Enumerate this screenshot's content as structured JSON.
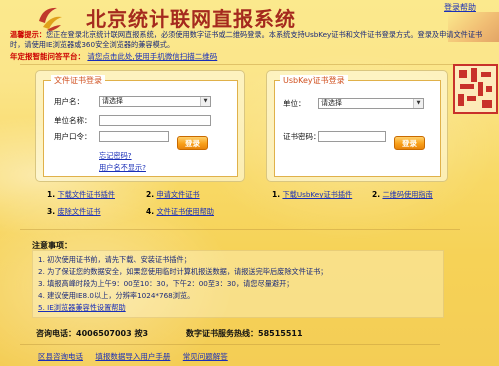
{
  "header": {
    "site_title": "北京统计联网直报系统",
    "login_help": "登录帮助"
  },
  "notice": {
    "label": "温馨提示：",
    "text": "您正在登录北京统计联网直报系统，必须使用数字证书或二维码登录。本系统支持UsbKey证书和文件证书登录方式。登录及申请文件证书时，请使用IE浏览器或360安全浏览器的兼容模式。",
    "wechat_label": "年定报智能问答平台：",
    "wechat_link": "请您点击此处,使用手机微信扫描二维码"
  },
  "file_cert_panel": {
    "title": "文件证书登录",
    "fields": [
      {
        "label": "用户名：",
        "value": "请选择"
      },
      {
        "label": "单位名称：",
        "value": ""
      },
      {
        "label": "用户口令：",
        "value": ""
      }
    ],
    "login_button": "登录",
    "forgot_password": "忘记密码?",
    "username_missing": "用户名不显示?",
    "links": [
      {
        "num": "1.",
        "text": "下载文件证书插件"
      },
      {
        "num": "2.",
        "text": "申请文件证书"
      },
      {
        "num": "3.",
        "text": "废除文件证书"
      },
      {
        "num": "4.",
        "text": "文件证书使用帮助"
      }
    ]
  },
  "usbkey_panel": {
    "title": "UsbKey证书登录",
    "fields": [
      {
        "label": "单位：",
        "value": "请选择"
      },
      {
        "label": "证书密码：",
        "value": ""
      }
    ],
    "login_button": "登录",
    "links": [
      {
        "num": "1.",
        "text": "下载UsbKey证书插件"
      },
      {
        "num": "2.",
        "text": "二维码使用指南"
      }
    ]
  },
  "notes": {
    "title": "注意事项：",
    "items": [
      "1. 初次使用证书前，请先下载、安装证书插件；",
      "2. 为了保证您的数据安全，如果您使用临时计算机报送数据，请报送完毕后废除文件证书；",
      "3. 填报高峰时段为上午9：00至10：30，下午2：00至3：30，请您尽量避开；",
      "4. 建议使用IE8.0以上，分辨率1024*768浏览。",
      "5. IE浏览器兼容性设置帮助"
    ]
  },
  "hotlines": {
    "consult": "咨询电话：4006507003 按3",
    "cert": "数字证书服务热线：58515511"
  },
  "footer_links": [
    "区县咨询电话",
    "填报数据导入用户手册",
    "常见问题解答"
  ],
  "colors": {
    "title_red": "#a52a1e",
    "link_blue": "#1a2fb8",
    "accent_orange": "#f9a01a",
    "background_gold": "#f8d966"
  }
}
